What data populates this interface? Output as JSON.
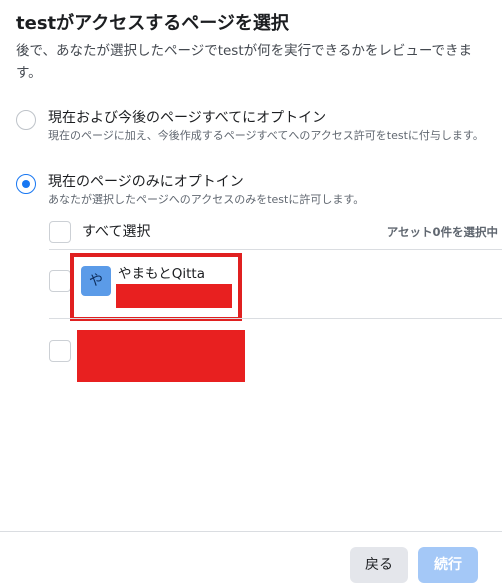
{
  "dialog": {
    "title": "testがアクセスするページを選択",
    "subtitle": "後で、あなたが選択したページでtestが何を実行できるかをレビューできます。"
  },
  "options": [
    {
      "label": "現在および今後のページすべてにオプトイン",
      "description": "現在のページに加え、今後作成するページすべてへのアクセス許可をtestに付与します。",
      "selected": false
    },
    {
      "label": "現在のページのみにオプトイン",
      "description": "あなたが選択したページへのアクセスのみをtestに許可します。",
      "selected": true
    }
  ],
  "asset_list": {
    "select_all_label": "すべて選択",
    "selected_count_label": "アセット0件を選択中",
    "items": [
      {
        "avatar_char": "や",
        "name": "やまもとQitta",
        "checked": false,
        "avatar_color": "#5b9be8"
      },
      {
        "checked": false
      }
    ]
  },
  "footer": {
    "back_label": "戻る",
    "continue_label": "続行"
  },
  "colors": {
    "accent": "#1877f2",
    "continue_disabled": "#a4c8f7",
    "redaction": "#e82020"
  }
}
